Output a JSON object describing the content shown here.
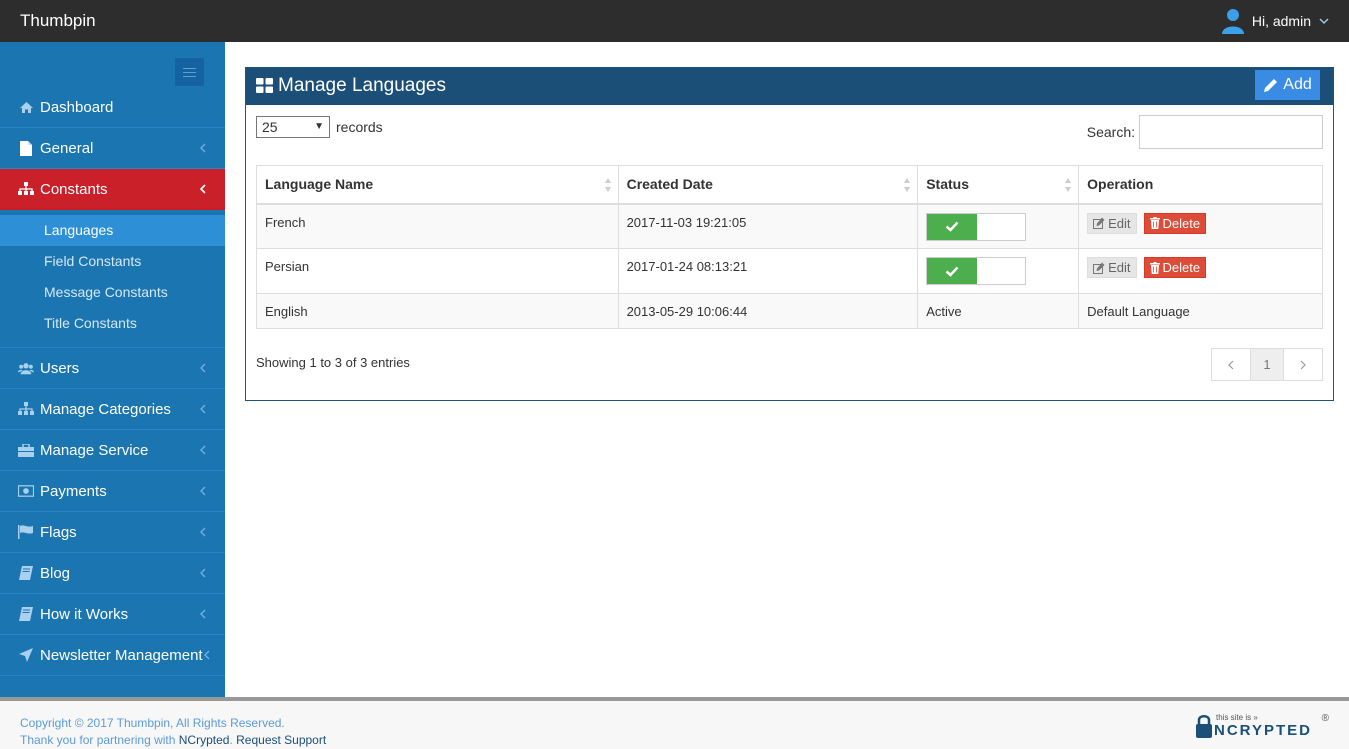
{
  "app": {
    "brand": "Thumbpin"
  },
  "user": {
    "greeting": "Hi, admin"
  },
  "sidebar": {
    "items": [
      {
        "label": "Dashboard",
        "icon": "home-icon"
      },
      {
        "label": "General",
        "icon": "file-icon"
      },
      {
        "label": "Constants",
        "icon": "sitemap-icon"
      },
      {
        "label": "Users",
        "icon": "users-icon"
      },
      {
        "label": "Manage Categories",
        "icon": "sitemap-icon"
      },
      {
        "label": "Manage Service",
        "icon": "briefcase-icon"
      },
      {
        "label": "Payments",
        "icon": "money-icon"
      },
      {
        "label": "Flags",
        "icon": "flag-icon"
      },
      {
        "label": "Blog",
        "icon": "book-icon"
      },
      {
        "label": "How it Works",
        "icon": "book-icon"
      },
      {
        "label": "Newsletter Management",
        "icon": "send-icon"
      }
    ],
    "constants_sub": [
      "Languages",
      "Field Constants",
      "Message Constants",
      "Title Constants"
    ],
    "active_color": "#c9202a",
    "bg_color": "#1a75b1"
  },
  "panel": {
    "title": "Manage Languages",
    "add_label": "Add",
    "records_value": "25",
    "records_label": "records",
    "search_label": "Search:",
    "columns": [
      "Language Name",
      "Created Date",
      "Status",
      "Operation"
    ],
    "rows": [
      {
        "name": "French",
        "date": "2017-11-03 19:21:05",
        "status": "toggle-on",
        "ops": [
          "Edit",
          "Delete"
        ]
      },
      {
        "name": "Persian",
        "date": "2017-01-24 08:13:21",
        "status": "toggle-on",
        "ops": [
          "Edit",
          "Delete"
        ]
      },
      {
        "name": "English",
        "date": "2013-05-29 10:06:44",
        "status": "Active",
        "operation_text": "Default Language"
      }
    ],
    "info": "Showing 1 to 3 of 3 entries",
    "page": "1"
  },
  "footer": {
    "copyright": "Copyright © 2017 Thumbpin, All Rights Reserved.",
    "partner_prefix": "Thank you for partnering with",
    "partner_name": "NCrypted",
    "support": "Request Support",
    "badge_small": "this site is »",
    "badge_big": "NCRYPTED",
    "badge_reg": "®"
  }
}
